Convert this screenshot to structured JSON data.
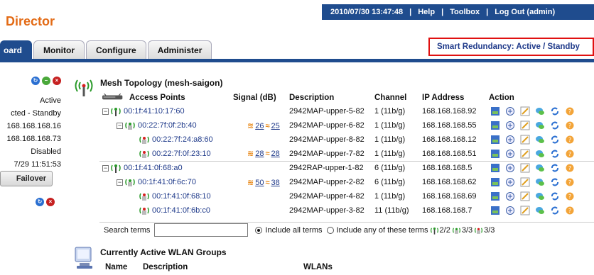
{
  "app": {
    "title": "Director"
  },
  "status": {
    "datetime": "2010/07/30 13:47:48",
    "help": "Help",
    "toolbox": "Toolbox",
    "logout": "Log Out (admin)"
  },
  "tabs": [
    {
      "label": "oard",
      "active": true
    },
    {
      "label": "Monitor",
      "active": false
    },
    {
      "label": "Configure",
      "active": false
    },
    {
      "label": "Administer",
      "active": false
    }
  ],
  "redundancy": {
    "text": "Smart Redundancy: Active / Standby"
  },
  "left_panel": {
    "rows": [
      "Active",
      "cted - Standby",
      "168.168.168.16",
      "168.168.168.73",
      "Disabled",
      "7/29 11:51:53"
    ],
    "failover_label": "Failover"
  },
  "mesh": {
    "title": "Mesh Topology (mesh-saigon)",
    "columns": [
      "Access Points",
      "Signal (dB)",
      "Description",
      "Channel",
      "IP Address",
      "Action"
    ],
    "rows": [
      {
        "level": 0,
        "mac": "00:1f:41:10:17:60",
        "signal_a": "",
        "signal_b": "",
        "desc": "2942MAP-upper-5-82",
        "channel": "1 (11b/g)",
        "ip": "168.168.168.92"
      },
      {
        "level": 1,
        "mac": "00:22:7f:0f:2b:40",
        "signal_a": "26",
        "signal_b": "25",
        "desc": "2942MAP-upper-6-82",
        "channel": "1 (11b/g)",
        "ip": "168.168.168.55"
      },
      {
        "level": 2,
        "mac": "00:22:7f:24:a8:60",
        "signal_a": "",
        "signal_b": "",
        "desc": "2942MAP-upper-8-82",
        "channel": "1 (11b/g)",
        "ip": "168.168.168.12"
      },
      {
        "level": 2,
        "mac": "00:22:7f:0f:23:10",
        "signal_a": "28",
        "signal_b": "28",
        "desc": "2942MAP-upper-7-82",
        "channel": "1 (11b/g)",
        "ip": "168.168.168.51"
      },
      {
        "level": 0,
        "mac": "00:1f:41:0f:68:a0",
        "signal_a": "",
        "signal_b": "",
        "desc": "2942RAP-upper-1-82",
        "channel": "6 (11b/g)",
        "ip": "168.168.168.5"
      },
      {
        "level": 1,
        "mac": "00:1f:41:0f:6c:70",
        "signal_a": "50",
        "signal_b": "38",
        "desc": "2942MAP-upper-2-82",
        "channel": "6 (11b/g)",
        "ip": "168.168.168.62"
      },
      {
        "level": 2,
        "mac": "00:1f:41:0f:68:10",
        "signal_a": "",
        "signal_b": "",
        "desc": "2942MAP-upper-4-82",
        "channel": "1 (11b/g)",
        "ip": "168.168.168.69"
      },
      {
        "level": 2,
        "mac": "00:1f:41:0f:6b:c0",
        "signal_a": "",
        "signal_b": "",
        "desc": "2942MAP-upper-3-82",
        "channel": "11 (11b/g)",
        "ip": "168.168.168.7"
      }
    ]
  },
  "search": {
    "label": "Search terms",
    "value": "",
    "opt_all": "Include all terms",
    "opt_any": "Include any of these terms",
    "count_root": "2/2",
    "count_mid": "3/3",
    "count_leaf": "3/3"
  },
  "wlan": {
    "title": "Currently Active WLAN Groups",
    "columns": [
      "Name",
      "Description",
      "WLANs"
    ]
  },
  "colors": {
    "nav_blue": "#1f4c8e",
    "brand_orange": "#e36b16",
    "highlight_red": "#e01010"
  }
}
